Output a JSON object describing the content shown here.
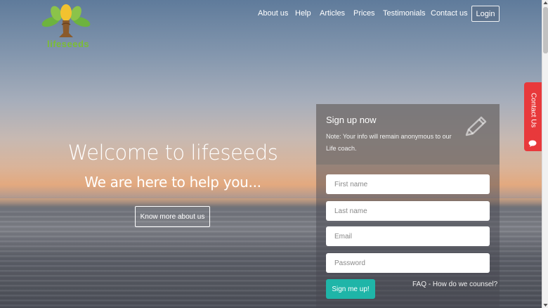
{
  "brand": {
    "name": "lifeseeds",
    "logo_icon": "tree-icon"
  },
  "nav": {
    "items": [
      "About us",
      "Help",
      "Articles",
      "Prices",
      "Testimonials",
      "Contact us"
    ],
    "login_label": "Login"
  },
  "hero": {
    "title": "Welcome to lifeseeds",
    "subtitle": "We are here to help you...",
    "button_label": "Know more about us"
  },
  "signup": {
    "title": "Sign up now",
    "note": "Note: Your info will remain anonymous to our Life coach.",
    "icon": "pencil-icon",
    "fields": {
      "first_name": {
        "placeholder": "First name"
      },
      "last_name": {
        "placeholder": "Last name"
      },
      "email": {
        "placeholder": "Email"
      },
      "password": {
        "placeholder": "Password"
      }
    },
    "submit_label": "Sign me up!",
    "faq_link": "FAQ - How do we counsel?"
  },
  "contact_tab": {
    "label": "Contact Us",
    "icon": "chat-bubble-icon",
    "color": "#e8393b"
  },
  "colors": {
    "accent": "#1fb5a8",
    "brand_green": "#7cbd35"
  }
}
